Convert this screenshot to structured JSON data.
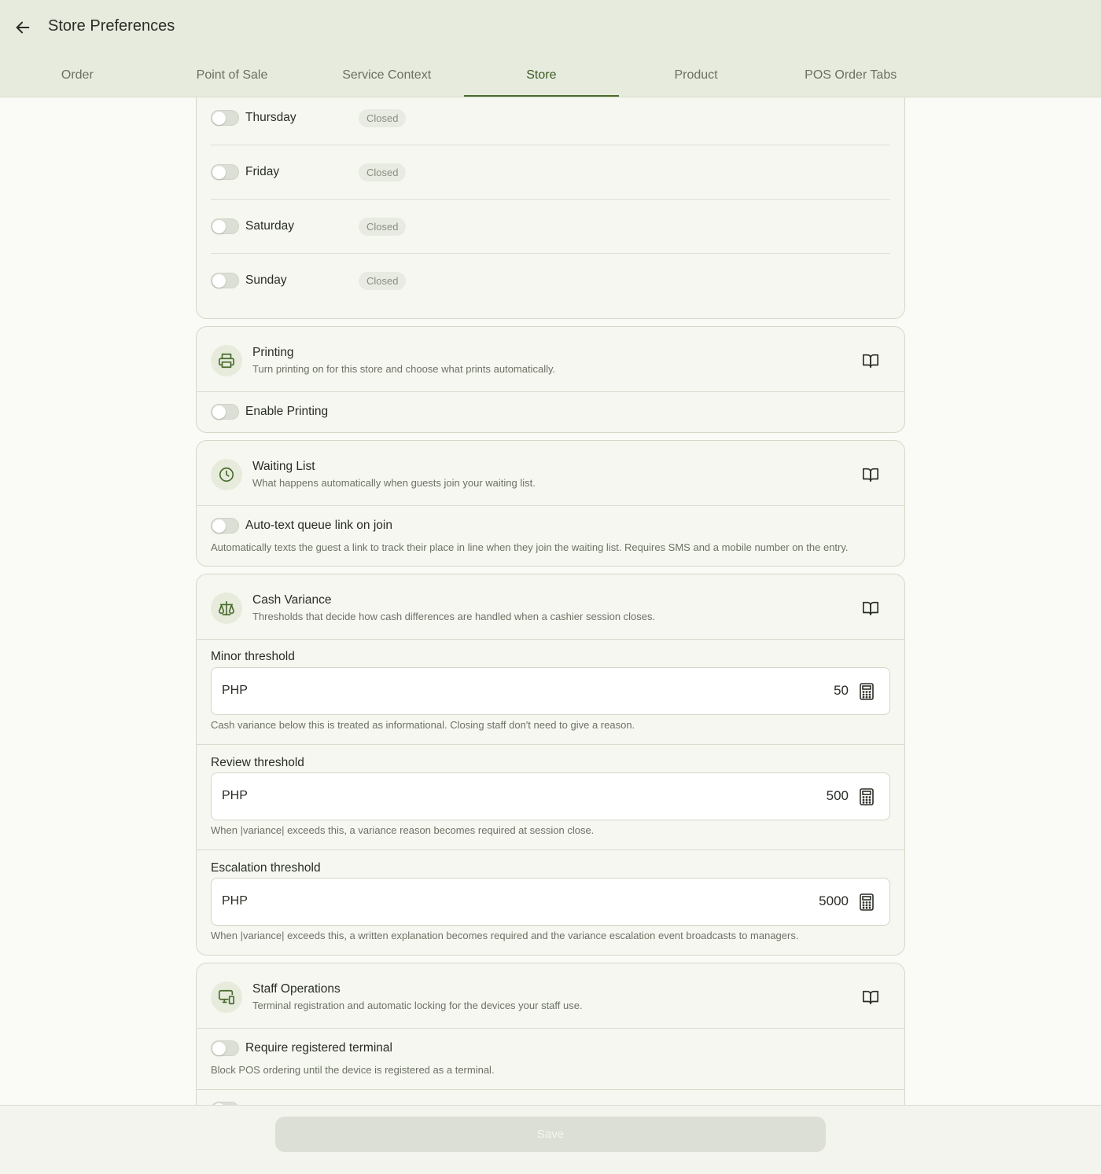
{
  "header": {
    "title": "Store Preferences",
    "tabs": [
      {
        "label": "Order"
      },
      {
        "label": "Point of Sale"
      },
      {
        "label": "Service Context"
      },
      {
        "label": "Store"
      },
      {
        "label": "Product"
      },
      {
        "label": "POS Order Tabs"
      }
    ],
    "active_tab": "Store"
  },
  "hours": {
    "days": [
      {
        "day": "Thursday",
        "status": "Closed",
        "enabled": false
      },
      {
        "day": "Friday",
        "status": "Closed",
        "enabled": false
      },
      {
        "day": "Saturday",
        "status": "Closed",
        "enabled": false
      },
      {
        "day": "Sunday",
        "status": "Closed",
        "enabled": false
      }
    ]
  },
  "printing": {
    "title": "Printing",
    "subtitle": "Turn printing on for this store and choose what prints automatically.",
    "enable_label": "Enable Printing",
    "enabled": false
  },
  "waiting_list": {
    "title": "Waiting List",
    "subtitle": "What happens automatically when guests join your waiting list.",
    "auto_text_label": "Auto-text queue link on join",
    "auto_text_desc": "Automatically texts the guest a link to track their place in line when they join the waiting list. Requires SMS and a mobile number on the entry.",
    "enabled": false
  },
  "cash_variance": {
    "title": "Cash Variance",
    "subtitle": "Thresholds that decide how cash differences are handled when a cashier session closes.",
    "thresholds": [
      {
        "label": "Minor threshold",
        "currency": "PHP",
        "value": "50",
        "desc": "Cash variance below this is treated as informational. Closing staff don't need to give a reason."
      },
      {
        "label": "Review threshold",
        "currency": "PHP",
        "value": "500",
        "desc": "When |variance| exceeds this, a variance reason becomes required at session close."
      },
      {
        "label": "Escalation threshold",
        "currency": "PHP",
        "value": "5000",
        "desc": "When |variance| exceeds this, a written explanation becomes required and the variance escalation event broadcasts to managers."
      }
    ]
  },
  "staff_operations": {
    "title": "Staff Operations",
    "subtitle": "Terminal registration and automatic locking for the devices your staff use.",
    "require_terminal_label": "Require registered terminal",
    "require_terminal_desc": "Block POS ordering until the device is registered as a terminal.",
    "enabled": false
  },
  "footer": {
    "save_label": "Save"
  },
  "colors": {
    "accent": "#4a6b2d",
    "header_bg": "#e6ebde",
    "card_bg": "#f5f7f0"
  }
}
